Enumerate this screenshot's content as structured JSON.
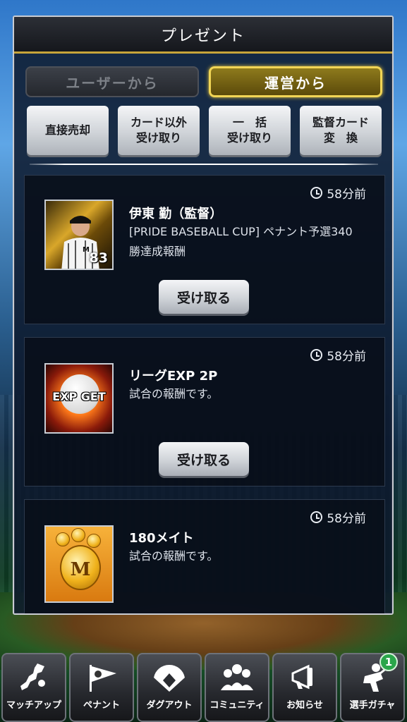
{
  "dialog": {
    "title": "プレゼント",
    "tabs": [
      {
        "label": "ユーザーから",
        "active": false
      },
      {
        "label": "運営から",
        "active": true
      }
    ],
    "actions": [
      {
        "line1": "直接売却",
        "line2": ""
      },
      {
        "line1": "カード以外",
        "line2": "受け取り"
      },
      {
        "line1": "一　括",
        "line2": "受け取り"
      },
      {
        "line1": "監督カード",
        "line2": "変　換"
      }
    ]
  },
  "presents": [
    {
      "time": "58分前",
      "title": "伊東 勤（監督）",
      "desc1": "[PRIDE BASEBALL CUP] ペナント予選340",
      "desc2": "勝達成報酬",
      "thumb_number": "83",
      "button": "受け取る"
    },
    {
      "time": "58分前",
      "title": "リーグEXP 2P",
      "desc1": "試合の報酬です。",
      "thumb_text": "EXP GET",
      "button": "受け取る"
    },
    {
      "time": "58分前",
      "title": "180メイト",
      "desc1": "試合の報酬です。",
      "thumb_text": "M"
    }
  ],
  "nav": [
    {
      "label": "マッチアップ",
      "icon": "japan-map-icon"
    },
    {
      "label": "ペナント",
      "icon": "pennant-flag-icon"
    },
    {
      "label": "ダグアウト",
      "icon": "baseball-diamond-icon"
    },
    {
      "label": "コミュニティ",
      "icon": "people-group-icon"
    },
    {
      "label": "お知らせ",
      "icon": "megaphone-icon"
    },
    {
      "label": "選手ガチャ",
      "icon": "player-gacha-icon",
      "badge": "1"
    }
  ],
  "colors": {
    "accent_gold": "#f1d555",
    "header_underline": "#c7a43a",
    "badge_green": "#2aa64a"
  }
}
